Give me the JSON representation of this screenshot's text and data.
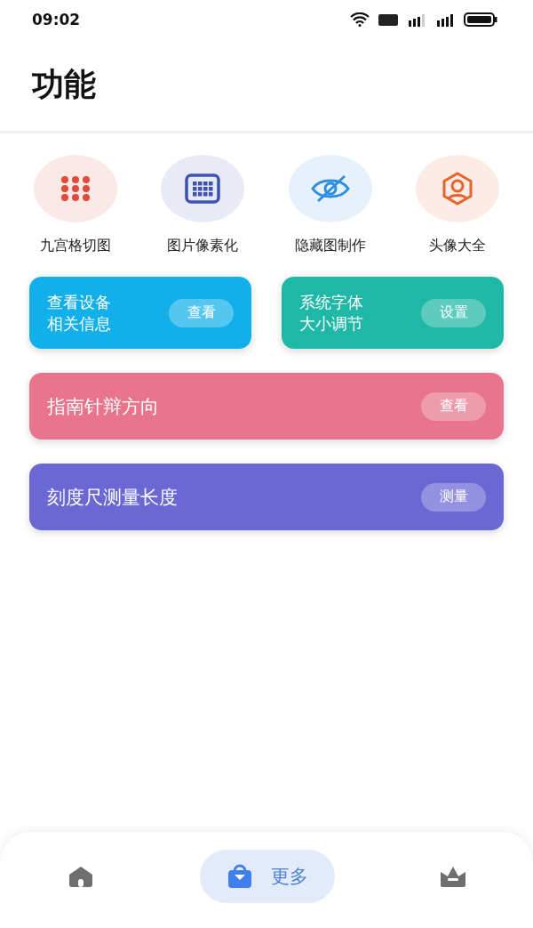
{
  "status_bar": {
    "time": "09:02"
  },
  "header": {
    "title": "功能"
  },
  "tools": [
    {
      "label": "九宫格切图",
      "color": "#e24a3b"
    },
    {
      "label": "图片像素化",
      "color": "#3f51b5"
    },
    {
      "label": "隐藏图制作",
      "color": "#2f8fde"
    },
    {
      "label": "头像大全",
      "color": "#e8622c"
    }
  ],
  "cards": [
    {
      "kind": "half",
      "lines": [
        "查看设备",
        "相关信息"
      ],
      "button": "查看",
      "color": "#12b0ea"
    },
    {
      "kind": "half",
      "lines": [
        "系统字体",
        "大小调节"
      ],
      "button": "设置",
      "color": "#1fb8a6"
    },
    {
      "kind": "wide",
      "lines": [
        "指南针辩方向"
      ],
      "button": "查看",
      "color": "#e8758c"
    },
    {
      "kind": "wide",
      "lines": [
        "刻度尺测量长度"
      ],
      "button": "测量",
      "color": "#6b68d4"
    }
  ],
  "nav": [
    {
      "selected": false
    },
    {
      "selected": true,
      "label": "更多"
    },
    {
      "selected": false
    }
  ]
}
